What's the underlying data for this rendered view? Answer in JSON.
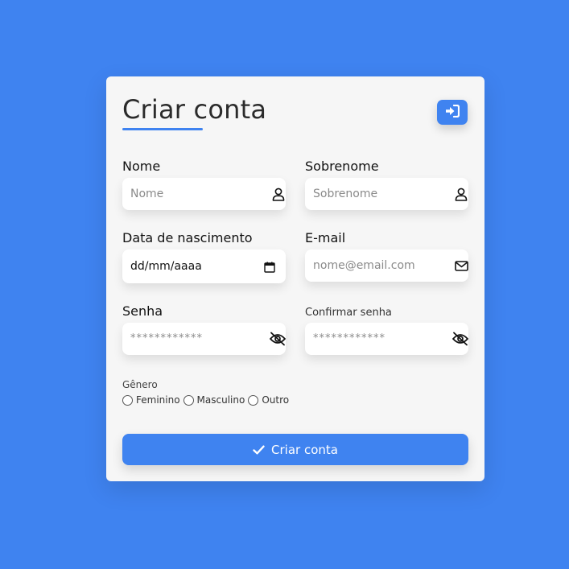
{
  "colors": {
    "background": "#3f83f0",
    "accent": "#3f83f0",
    "card": "#f6f6f6"
  },
  "header": {
    "title": "Criar conta",
    "login_icon": "sign-in-icon"
  },
  "fields": {
    "first_name": {
      "label": "Nome",
      "placeholder": "Nome",
      "icon": "user-icon"
    },
    "last_name": {
      "label": "Sobrenome",
      "placeholder": "Sobrenome",
      "icon": "user-icon"
    },
    "birthdate": {
      "label": "Data de nascimento",
      "value": "dd/mm/aaaa",
      "icon": "calendar-icon"
    },
    "email": {
      "label": "E-mail",
      "placeholder": "nome@email.com",
      "icon": "envelope-icon"
    },
    "password": {
      "label": "Senha",
      "placeholder": "************",
      "icon": "eye-slash-icon"
    },
    "confirm_password": {
      "label": "Confirmar senha",
      "placeholder": "************",
      "icon": "eye-slash-icon"
    }
  },
  "gender": {
    "label": "Gênero",
    "options": [
      "Feminino",
      "Masculino",
      "Outro"
    ]
  },
  "submit": {
    "label": "Criar conta",
    "icon": "check-icon"
  }
}
